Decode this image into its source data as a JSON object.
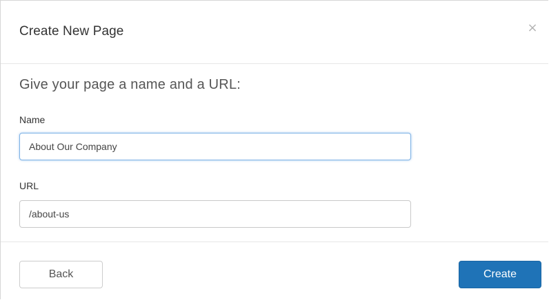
{
  "dialog": {
    "title": "Create New Page",
    "close_glyph": "×",
    "intro": "Give your page a name and a URL:"
  },
  "form": {
    "name": {
      "label": "Name",
      "value": "About Our Company"
    },
    "url": {
      "label": "URL",
      "value": "/about-us"
    }
  },
  "footer": {
    "back_label": "Back",
    "create_label": "Create"
  },
  "colors": {
    "primary": "#1f73b7",
    "focus_border": "#7fb2e5",
    "border": "#c8c8c8",
    "text": "#333333"
  }
}
